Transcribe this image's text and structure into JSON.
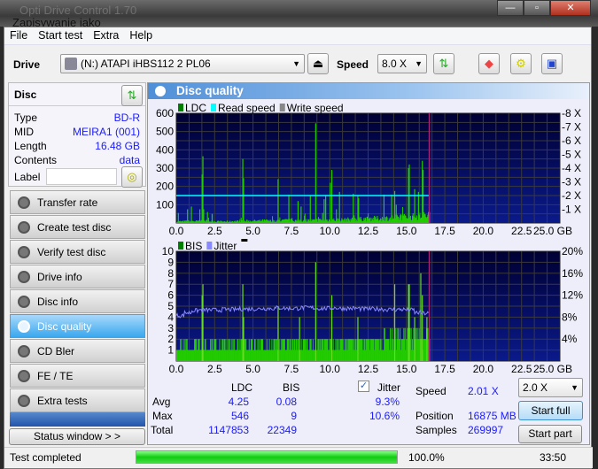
{
  "window": {
    "title": "Opti Drive Control 1.70",
    "overlay_title": "Zapisywanie jako"
  },
  "menu": [
    "File",
    "Start test",
    "Extra",
    "Help"
  ],
  "toolbar": {
    "drive_label": "Drive",
    "drive_value": "(N:)  ATAPI iHBS112   2 PL06",
    "speed_label": "Speed",
    "speed_value": "8.0 X"
  },
  "disc": {
    "title": "Disc",
    "fields": [
      {
        "k": "Type",
        "v": "BD-R"
      },
      {
        "k": "MID",
        "v": "MEIRA1 (001)"
      },
      {
        "k": "Length",
        "v": "16.48 GB"
      },
      {
        "k": "Contents",
        "v": "data"
      }
    ],
    "label_label": "Label",
    "label_value": ""
  },
  "nav": [
    {
      "label": "Transfer rate"
    },
    {
      "label": "Create test disc"
    },
    {
      "label": "Verify test disc"
    },
    {
      "label": "Drive info"
    },
    {
      "label": "Disc info"
    },
    {
      "label": "Disc quality",
      "active": true
    },
    {
      "label": "CD Bler"
    },
    {
      "label": "FE / TE"
    },
    {
      "label": "Extra tests"
    }
  ],
  "status_window_label": "Status window > >",
  "panel_title": "Disc quality",
  "chart_data": [
    {
      "type": "bar",
      "legend": [
        "LDC",
        "Read speed",
        "Write speed"
      ],
      "colors": {
        "LDC": "#22cc00",
        "Read speed": "#00ffff",
        "Write speed": "#888888",
        "bg": "#000066"
      },
      "ylim": [
        0,
        600
      ],
      "yticks": [
        100,
        200,
        300,
        400,
        500,
        600
      ],
      "y2ticks": [
        "1 X",
        "2 X",
        "3 X",
        "4 X",
        "5 X",
        "6 X",
        "7 X",
        "8 X"
      ],
      "y2lim": [
        0,
        8
      ],
      "xlim": [
        0,
        25
      ],
      "xticks": [
        "0.0",
        "2.5",
        "5.0",
        "7.5",
        "10.0",
        "12.5",
        "15.0",
        "17.5",
        "20.0",
        "22.5",
        "25.0 GB"
      ],
      "end_gb": 16.48,
      "read_speed_x": 2.0,
      "ldc_baseline_step_gb": 0.5,
      "ldc_baseline": [
        10,
        12,
        12,
        14,
        12,
        10,
        10,
        12,
        12,
        14,
        14,
        16,
        14,
        16,
        18,
        16,
        18,
        18,
        20,
        20,
        22,
        22,
        24,
        26,
        28,
        30,
        30,
        32,
        36,
        40,
        42,
        45,
        48
      ],
      "ldc_spikes": [
        [
          0.1,
          55
        ],
        [
          0.7,
          75
        ],
        [
          0.95,
          90
        ],
        [
          1.5,
          75
        ],
        [
          1.65,
          265
        ],
        [
          1.7,
          365
        ],
        [
          1.75,
          75
        ],
        [
          2.0,
          60
        ],
        [
          2.3,
          50
        ],
        [
          4.3,
          350
        ],
        [
          4.35,
          245
        ],
        [
          6.6,
          240
        ],
        [
          7.3,
          155
        ],
        [
          7.9,
          120
        ],
        [
          8.1,
          90
        ],
        [
          8.7,
          150
        ],
        [
          9.05,
          545
        ],
        [
          9.5,
          55
        ],
        [
          9.6,
          130
        ],
        [
          9.7,
          150
        ],
        [
          10.0,
          220
        ],
        [
          10.1,
          290
        ],
        [
          10.4,
          75
        ],
        [
          10.6,
          170
        ],
        [
          11.5,
          160
        ],
        [
          11.8,
          150
        ],
        [
          11.85,
          135
        ],
        [
          13.5,
          155
        ],
        [
          14.0,
          155
        ],
        [
          14.2,
          175
        ],
        [
          14.3,
          100
        ],
        [
          15.1,
          300
        ],
        [
          15.15,
          320
        ],
        [
          15.5,
          185
        ],
        [
          15.75,
          170
        ],
        [
          16.0,
          340
        ],
        [
          16.05,
          290
        ],
        [
          16.4,
          60
        ]
      ]
    },
    {
      "type": "bar",
      "legend": [
        "BIS",
        "Jitter"
      ],
      "colors": {
        "BIS": "#22cc00",
        "Jitter": "#8888ff",
        "bg": "#000066"
      },
      "ylim": [
        0,
        10
      ],
      "yticks": [
        1,
        2,
        3,
        4,
        5,
        6,
        7,
        8,
        9,
        10
      ],
      "y2ticks": [
        "4%",
        "8%",
        "12%",
        "16%",
        "20%"
      ],
      "y2lim": [
        0,
        20
      ],
      "xlim": [
        0,
        25
      ],
      "xticks": [
        "0.0",
        "2.5",
        "5.0",
        "7.5",
        "10.0",
        "12.5",
        "15.0",
        "17.5",
        "20.0",
        "22.5",
        "25.0 GB"
      ],
      "end_gb": 16.48,
      "bis_typical": [
        1,
        2
      ],
      "bis_spikes": [
        [
          1.65,
          6
        ],
        [
          1.7,
          7
        ],
        [
          4.3,
          7
        ],
        [
          4.35,
          4
        ],
        [
          6.6,
          5
        ],
        [
          8.0,
          4
        ],
        [
          9.05,
          9
        ],
        [
          10.1,
          6
        ],
        [
          11.8,
          4
        ],
        [
          14.2,
          7
        ],
        [
          15.1,
          7
        ],
        [
          15.15,
          7
        ],
        [
          15.5,
          4
        ],
        [
          15.9,
          8
        ],
        [
          16.0,
          6
        ],
        [
          16.3,
          4
        ]
      ],
      "jitter_step_gb": 0.5,
      "jitter_pct": [
        8.3,
        8.8,
        9.2,
        9.3,
        9.3,
        9.3,
        9.4,
        9.4,
        9.5,
        9.5,
        9.5,
        9.6,
        9.6,
        9.7,
        9.6,
        9.6,
        9.7,
        9.7,
        9.6,
        9.6,
        9.7,
        9.6,
        9.6,
        9.6,
        9.5,
        9.5,
        9.5,
        9.4,
        9.4,
        9.4,
        9.3,
        8.8,
        8.7
      ]
    }
  ],
  "stats": {
    "col_ldc": "LDC",
    "col_bis": "BIS",
    "jitter_label": "Jitter",
    "jitter_checked": true,
    "avg_label": "Avg",
    "max_label": "Max",
    "total_label": "Total",
    "avg_ldc": "4.25",
    "avg_bis": "0.08",
    "avg_jitter": "9.3%",
    "max_ldc": "546",
    "max_bis": "9",
    "max_jitter": "10.6%",
    "total_ldc": "1147853",
    "total_bis": "22349",
    "speed_label": "Speed",
    "speed_value": "2.01 X",
    "position_label": "Position",
    "position_value": "16875 MB",
    "samples_label": "Samples",
    "samples_value": "269997",
    "speed_select": "2.0 X",
    "start_full": "Start full",
    "start_part": "Start part"
  },
  "status": {
    "text": "Test completed",
    "progress_pct": 100,
    "progress_label": "100.0%",
    "time": "33:50"
  }
}
